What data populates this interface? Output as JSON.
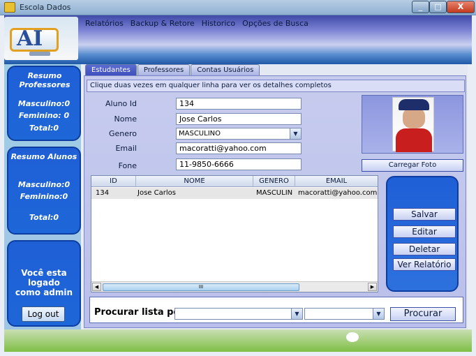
{
  "window": {
    "title": "Escola Dados"
  },
  "menu": [
    "Relatórios",
    "Backup & Retore",
    "Historico",
    "Opções de Busca"
  ],
  "tabs": [
    "Estudantes",
    "Professores",
    "Contas Usuários"
  ],
  "info": "Clique duas vezes em qualquer linha para ver os detalhes completos",
  "professores": {
    "title": "Resumo Professores",
    "masculino": "Masculino:0",
    "feminino": "Feminino: 0",
    "total": "Total:0"
  },
  "alunos": {
    "title": "Resumo Alunos",
    "masculino": "Masculino:0",
    "feminino": "Feminino:0",
    "total": "Total:0"
  },
  "login": {
    "message": "Você esta logado como admin",
    "logout": "Log out"
  },
  "form": {
    "aluno_id_label": "Aluno Id",
    "aluno_id": "134",
    "nome_label": "Nome",
    "nome": "Jose Carlos",
    "genero_label": "Genero",
    "genero": "MASCULINO",
    "email_label": "Email",
    "email": "macoratti@yahoo.com",
    "fone_label": "Fone",
    "fone": "11-9850-6666"
  },
  "photo": {
    "button": "Carregar Foto"
  },
  "grid": {
    "columns": [
      "ID",
      "NOME",
      "GENERO",
      "EMAIL"
    ],
    "rows": [
      [
        "134",
        "Jose Carlos",
        "MASCULIN",
        "macoratti@yahoo.com"
      ]
    ],
    "scroll_thumb": "III"
  },
  "actions": {
    "salvar": "Salvar",
    "editar": "Editar",
    "deletar": "Deletar",
    "relatorio": "Ver Relatório"
  },
  "search": {
    "label": "Procurar lista por",
    "field1": "",
    "field2": "",
    "button": "Procurar"
  },
  "window_buttons": {
    "min": "_",
    "max": "□",
    "close": "X"
  }
}
